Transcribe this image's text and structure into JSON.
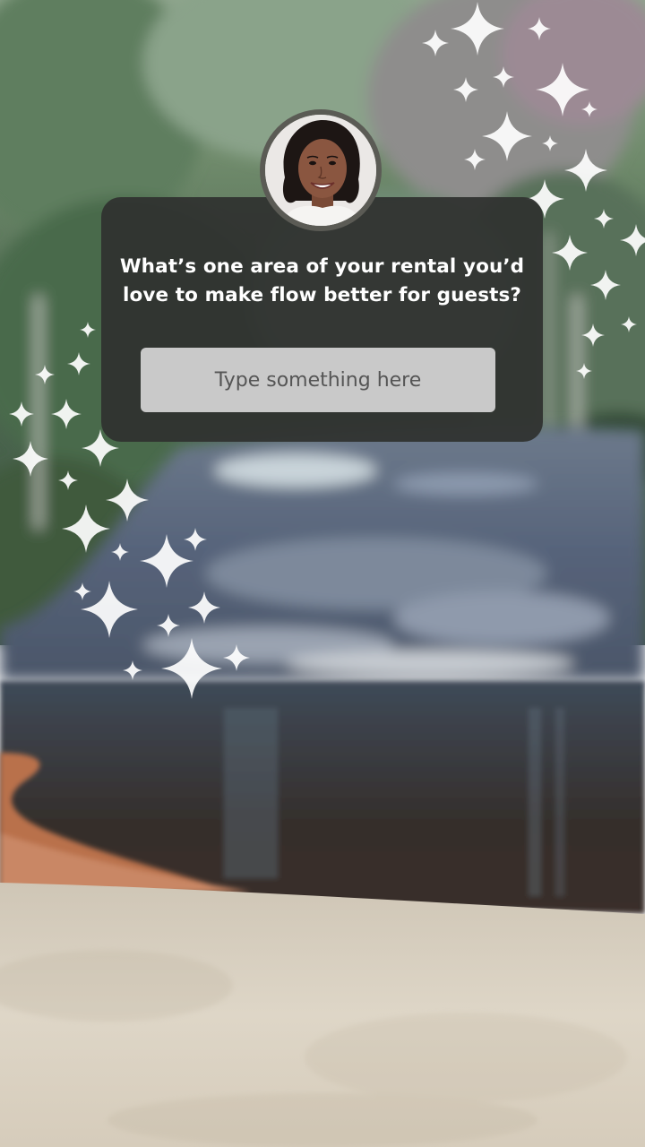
{
  "story": {
    "background": "blurred-river-forest-photo",
    "decoration": "sparkle-icon",
    "question_sticker": {
      "avatar": "profile-photo-avatar",
      "question": "What’s one area of your rental you’d love to make flow better for guests?",
      "answer_placeholder": "Type something here",
      "card_color": "#303230",
      "field_color": "#c9c9c9"
    }
  }
}
